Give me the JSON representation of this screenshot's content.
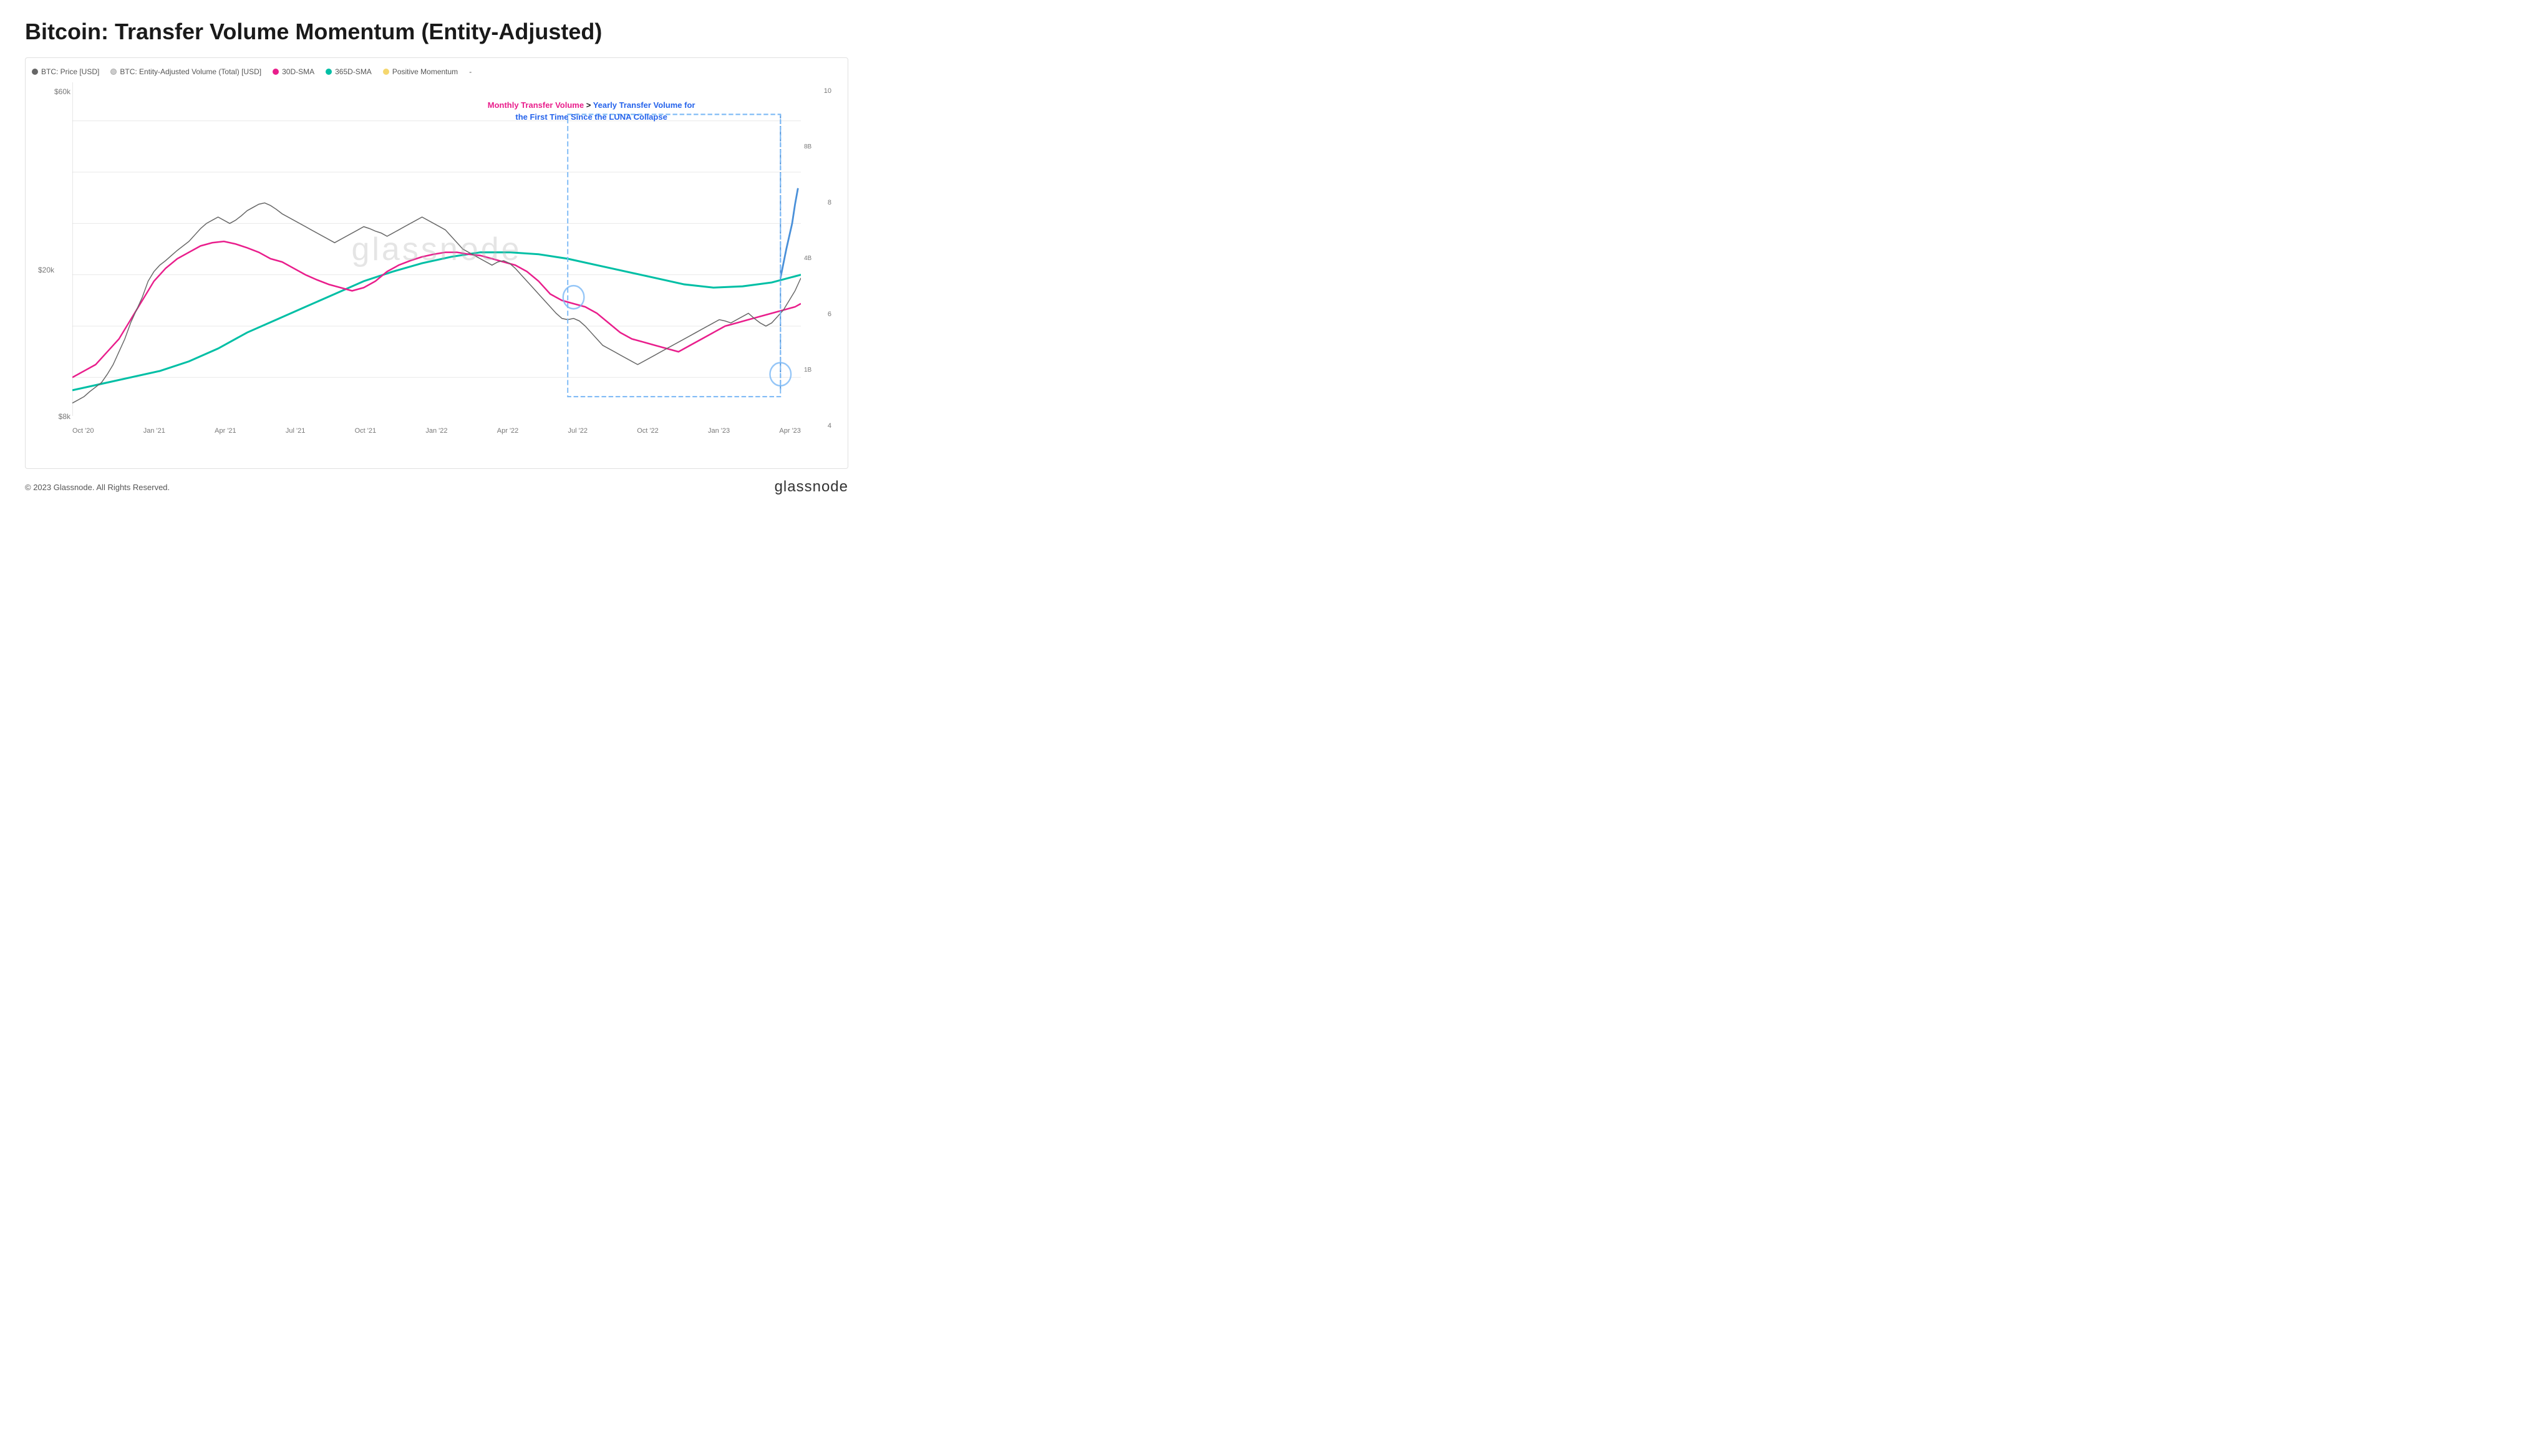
{
  "page": {
    "title": "Bitcoin: Transfer Volume Momentum (Entity-Adjusted)",
    "footer_copyright": "© 2023 Glassnode. All Rights Reserved.",
    "footer_logo": "glassnode",
    "watermark": "glassnode"
  },
  "legend": {
    "items": [
      {
        "id": "btc-price",
        "label": "BTC: Price [USD]",
        "color": "#555555",
        "type": "dot"
      },
      {
        "id": "btc-volume",
        "label": "BTC: Entity-Adjusted Volume (Total) [USD]",
        "color": "#cccccc",
        "type": "dot"
      },
      {
        "id": "30d-sma",
        "label": "30D-SMA",
        "color": "#e91e8c",
        "type": "dot"
      },
      {
        "id": "365d-sma",
        "label": "365D-SMA",
        "color": "#00bfa5",
        "type": "dot"
      },
      {
        "id": "positive-momentum",
        "label": "Positive Momentum",
        "color": "#f5c842",
        "type": "dot"
      },
      {
        "id": "dash",
        "label": "-",
        "color": "#999",
        "type": "text"
      }
    ]
  },
  "annotation": {
    "pink_text": "Monthly Transfer Volume",
    "connector": ">",
    "blue_text": "Yearly Transfer Volume for",
    "blue_text2": "the First Time Since the LUNA Collapse"
  },
  "y_axis_left": [
    "$8k",
    "$20k",
    "$60k"
  ],
  "y_axis_right_primary": [
    "4",
    "6",
    "8",
    "10"
  ],
  "y_axis_right_labels": [
    "1B",
    "4B",
    "8B"
  ],
  "x_axis": [
    "Oct '20",
    "Jan '21",
    "Apr '21",
    "Jul '21",
    "Oct '21",
    "Jan '22",
    "Apr '22",
    "Jul '22",
    "Oct '22",
    "Jan '23",
    "Apr '23"
  ],
  "chart": {
    "accent_blue": "#2563eb",
    "accent_pink": "#e91e8c",
    "accent_teal": "#00bfa5",
    "accent_gray": "#888888",
    "annotation_box_color": "#7ab8f5"
  }
}
